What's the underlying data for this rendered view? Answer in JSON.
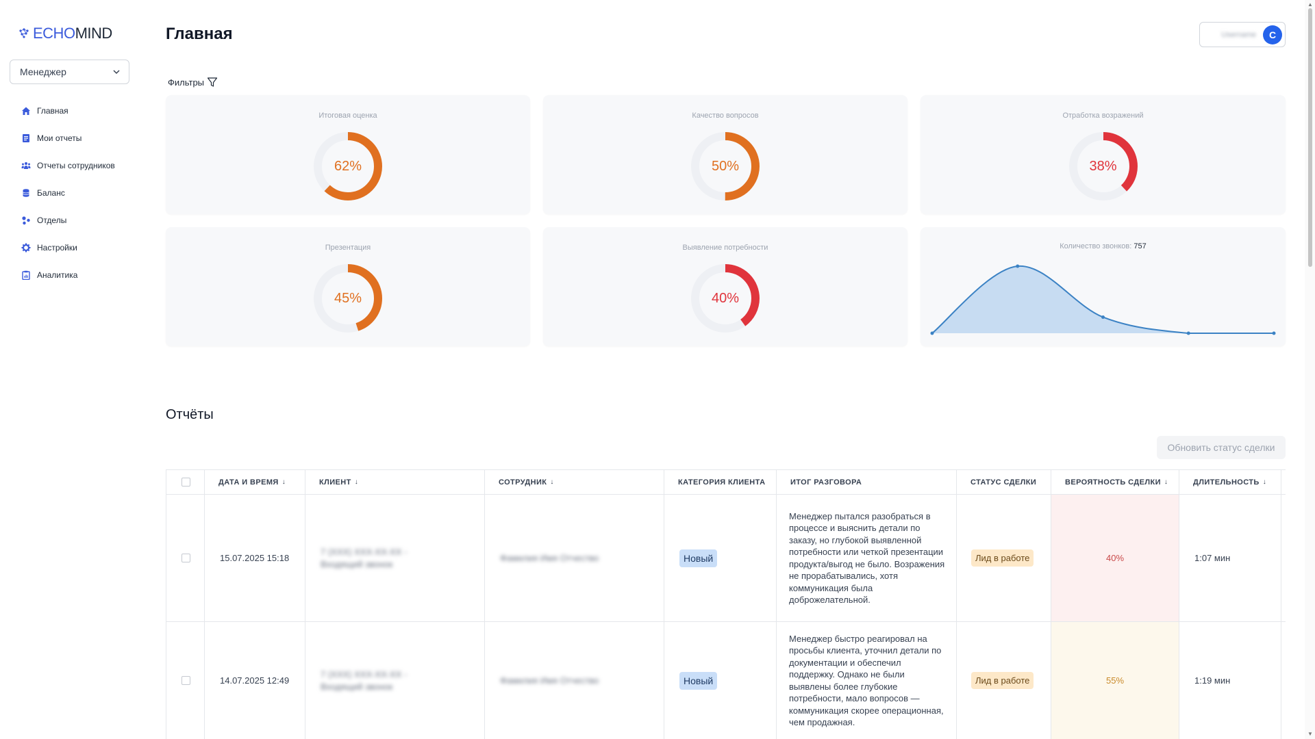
{
  "app": {
    "logo_echo": "ECHO",
    "logo_mind": "MIND",
    "role_selected": "Менеджер",
    "page_title": "Главная",
    "user_name": "Username",
    "user_initial": "С"
  },
  "sidebar": {
    "items": [
      {
        "label": "Главная",
        "icon": "home-icon"
      },
      {
        "label": "Мои отчеты",
        "icon": "document-icon"
      },
      {
        "label": "Отчеты сотрудников",
        "icon": "team-icon"
      },
      {
        "label": "Баланс",
        "icon": "coins-icon"
      },
      {
        "label": "Отделы",
        "icon": "departments-icon"
      },
      {
        "label": "Настройки",
        "icon": "gear-icon"
      },
      {
        "label": "Аналитика",
        "icon": "clipboard-icon"
      }
    ]
  },
  "filters": {
    "label": "Фильтры"
  },
  "metrics": [
    {
      "title": "Итоговая оценка",
      "value": "62%",
      "percent": 62,
      "color": "#e07020"
    },
    {
      "title": "Качество вопросов",
      "value": "50%",
      "percent": 50,
      "color": "#e07020"
    },
    {
      "title": "Отработка возражений",
      "value": "38%",
      "percent": 38,
      "color": "#e0343c"
    },
    {
      "title": "Презентация",
      "value": "45%",
      "percent": 45,
      "color": "#e07020"
    },
    {
      "title": "Выявление потребности",
      "value": "40%",
      "percent": 40,
      "color": "#e0343c"
    }
  ],
  "calls": {
    "title": "Количество звонков:",
    "count": "757"
  },
  "chart_data": {
    "type": "area",
    "title": "Количество звонков: 757",
    "x": [
      0,
      1,
      2,
      3,
      4
    ],
    "values": [
      0,
      100,
      24,
      0,
      0
    ],
    "color": "#3b82c4",
    "fill": "#c7dcf2",
    "grid": false
  },
  "reports": {
    "title": "Отчёты",
    "update_button": "Обновить статус сделки",
    "columns": [
      {
        "label": "ДАТА И ВРЕМЯ",
        "sort": "↓"
      },
      {
        "label": "КЛИЕНТ",
        "sort": "↓"
      },
      {
        "label": "СОТРУДНИК",
        "sort": "↓"
      },
      {
        "label": "КАТЕГОРИЯ КЛИЕНТА",
        "sort": ""
      },
      {
        "label": "ИТОГ РАЗГОВОРА",
        "sort": ""
      },
      {
        "label": "СТАТУС СДЕЛКИ",
        "sort": ""
      },
      {
        "label": "ВЕРОЯТНОСТЬ СДЕЛКИ",
        "sort": "↓"
      },
      {
        "label": "ДЛИТЕЛЬНОСТЬ",
        "sort": "↓"
      }
    ],
    "rows": [
      {
        "datetime": "15.07.2025 15:18",
        "client": "7 (XXX) XXX-XX-XX - Входящий звонок",
        "employee": "Фамилия Имя Отчество",
        "category": "Новый",
        "summary": "Менеджер пытался разобраться в процессе и выяснить детали по заказу, но глубокой выявленной потребности или четкой презентации продукта/выгод не было. Возражения не прорабатывались, хотя коммуникация была доброжелательной.",
        "status": "Лид в работе",
        "probability": "40%",
        "prob_bg": "#fdf0f0",
        "prob_color": "#c94a4a",
        "duration": "1:07 мин"
      },
      {
        "datetime": "14.07.2025 12:49",
        "client": "7 (XXX) XXX-XX-XX - Входящий звонок",
        "employee": "Фамилия Имя Отчество",
        "category": "Новый",
        "summary": "Менеджер быстро реагировал на просьбы клиента, уточнил детали по документации и обеспечил поддержку. Однако не были выявлены более глубокие потребности, мало вопросов — коммуникация скорее операционная, чем продажная.",
        "status": "Лид в работе",
        "probability": "55%",
        "prob_bg": "#fdf8ec",
        "prob_color": "#c98a2a",
        "duration": "1:19 мин"
      }
    ]
  }
}
